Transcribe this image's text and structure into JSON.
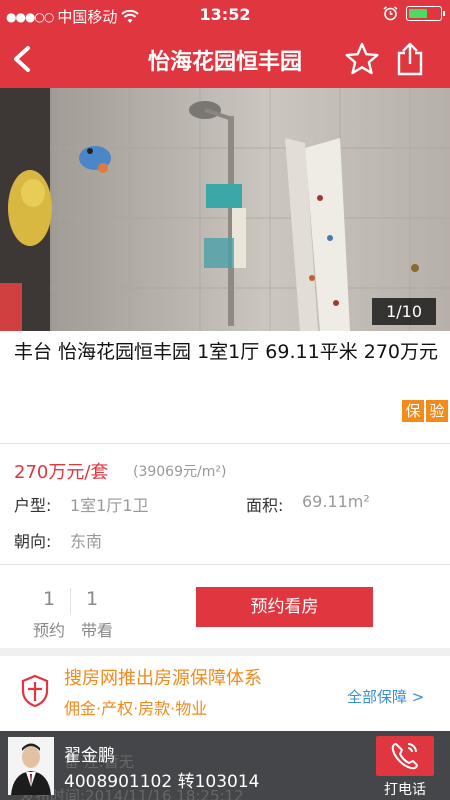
{
  "status_bar": {
    "carrier": "中国移动",
    "time": "13:52",
    "battery_level": 0.62
  },
  "nav": {
    "title": "怡海花园恒丰园"
  },
  "photo": {
    "counter": "1/10"
  },
  "listing": {
    "title": "丰台 怡海花园恒丰园 1室1厅 69.11平米 270万元",
    "tags": [
      "保",
      "验"
    ]
  },
  "price": {
    "total": "270万元/套",
    "unit": "(39069元/m²)"
  },
  "specs": {
    "layout_label": "户型:",
    "layout_value": "1室1厅1卫",
    "area_label": "面积:",
    "area_value": "69.11m²",
    "orientation_label": "朝向:",
    "orientation_value": "东南"
  },
  "counts": {
    "booked_num": "1",
    "booked_label": "预约",
    "viewed_num": "1",
    "viewed_label": "带看"
  },
  "actions": {
    "book_label": "预约看房"
  },
  "guarantee": {
    "title": "搜房网推出房源保障体系",
    "subtitle": "佣金·产权·房款·物业",
    "link": "全部保障 >"
  },
  "agent": {
    "name": "翟金鹏",
    "phone": "4008901102 转103014",
    "call_label": "打电话"
  },
  "colors": {
    "brand_red": "#e0363f",
    "accent_orange": "#f28a1c",
    "link_blue": "#3b8fd6"
  }
}
